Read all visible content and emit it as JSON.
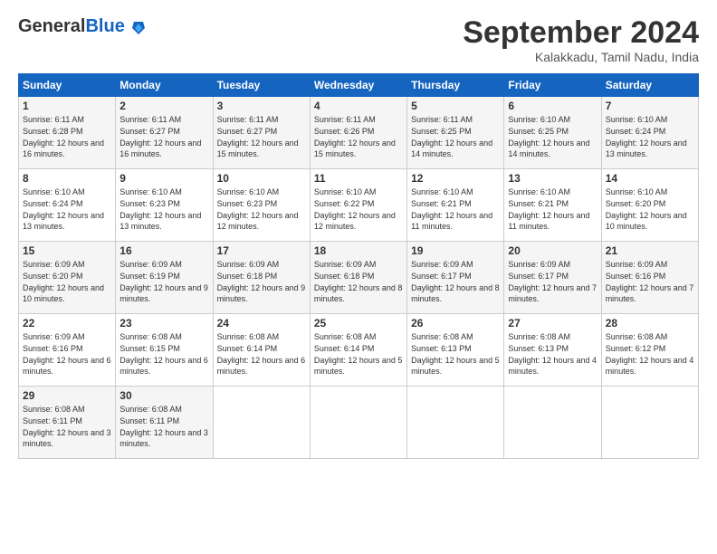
{
  "header": {
    "logo_general": "General",
    "logo_blue": "Blue",
    "month_title": "September 2024",
    "location": "Kalakkadu, Tamil Nadu, India"
  },
  "days_of_week": [
    "Sunday",
    "Monday",
    "Tuesday",
    "Wednesday",
    "Thursday",
    "Friday",
    "Saturday"
  ],
  "weeks": [
    [
      {
        "day": 1,
        "sunrise": "6:11 AM",
        "sunset": "6:28 PM",
        "daylight": "12 hours and 16 minutes."
      },
      {
        "day": 2,
        "sunrise": "6:11 AM",
        "sunset": "6:27 PM",
        "daylight": "12 hours and 16 minutes."
      },
      {
        "day": 3,
        "sunrise": "6:11 AM",
        "sunset": "6:27 PM",
        "daylight": "12 hours and 15 minutes."
      },
      {
        "day": 4,
        "sunrise": "6:11 AM",
        "sunset": "6:26 PM",
        "daylight": "12 hours and 15 minutes."
      },
      {
        "day": 5,
        "sunrise": "6:11 AM",
        "sunset": "6:25 PM",
        "daylight": "12 hours and 14 minutes."
      },
      {
        "day": 6,
        "sunrise": "6:10 AM",
        "sunset": "6:25 PM",
        "daylight": "12 hours and 14 minutes."
      },
      {
        "day": 7,
        "sunrise": "6:10 AM",
        "sunset": "6:24 PM",
        "daylight": "12 hours and 13 minutes."
      }
    ],
    [
      {
        "day": 8,
        "sunrise": "6:10 AM",
        "sunset": "6:24 PM",
        "daylight": "12 hours and 13 minutes."
      },
      {
        "day": 9,
        "sunrise": "6:10 AM",
        "sunset": "6:23 PM",
        "daylight": "12 hours and 13 minutes."
      },
      {
        "day": 10,
        "sunrise": "6:10 AM",
        "sunset": "6:23 PM",
        "daylight": "12 hours and 12 minutes."
      },
      {
        "day": 11,
        "sunrise": "6:10 AM",
        "sunset": "6:22 PM",
        "daylight": "12 hours and 12 minutes."
      },
      {
        "day": 12,
        "sunrise": "6:10 AM",
        "sunset": "6:21 PM",
        "daylight": "12 hours and 11 minutes."
      },
      {
        "day": 13,
        "sunrise": "6:10 AM",
        "sunset": "6:21 PM",
        "daylight": "12 hours and 11 minutes."
      },
      {
        "day": 14,
        "sunrise": "6:10 AM",
        "sunset": "6:20 PM",
        "daylight": "12 hours and 10 minutes."
      }
    ],
    [
      {
        "day": 15,
        "sunrise": "6:09 AM",
        "sunset": "6:20 PM",
        "daylight": "12 hours and 10 minutes."
      },
      {
        "day": 16,
        "sunrise": "6:09 AM",
        "sunset": "6:19 PM",
        "daylight": "12 hours and 9 minutes."
      },
      {
        "day": 17,
        "sunrise": "6:09 AM",
        "sunset": "6:18 PM",
        "daylight": "12 hours and 9 minutes."
      },
      {
        "day": 18,
        "sunrise": "6:09 AM",
        "sunset": "6:18 PM",
        "daylight": "12 hours and 8 minutes."
      },
      {
        "day": 19,
        "sunrise": "6:09 AM",
        "sunset": "6:17 PM",
        "daylight": "12 hours and 8 minutes."
      },
      {
        "day": 20,
        "sunrise": "6:09 AM",
        "sunset": "6:17 PM",
        "daylight": "12 hours and 7 minutes."
      },
      {
        "day": 21,
        "sunrise": "6:09 AM",
        "sunset": "6:16 PM",
        "daylight": "12 hours and 7 minutes."
      }
    ],
    [
      {
        "day": 22,
        "sunrise": "6:09 AM",
        "sunset": "6:16 PM",
        "daylight": "12 hours and 6 minutes."
      },
      {
        "day": 23,
        "sunrise": "6:08 AM",
        "sunset": "6:15 PM",
        "daylight": "12 hours and 6 minutes."
      },
      {
        "day": 24,
        "sunrise": "6:08 AM",
        "sunset": "6:14 PM",
        "daylight": "12 hours and 6 minutes."
      },
      {
        "day": 25,
        "sunrise": "6:08 AM",
        "sunset": "6:14 PM",
        "daylight": "12 hours and 5 minutes."
      },
      {
        "day": 26,
        "sunrise": "6:08 AM",
        "sunset": "6:13 PM",
        "daylight": "12 hours and 5 minutes."
      },
      {
        "day": 27,
        "sunrise": "6:08 AM",
        "sunset": "6:13 PM",
        "daylight": "12 hours and 4 minutes."
      },
      {
        "day": 28,
        "sunrise": "6:08 AM",
        "sunset": "6:12 PM",
        "daylight": "12 hours and 4 minutes."
      }
    ],
    [
      {
        "day": 29,
        "sunrise": "6:08 AM",
        "sunset": "6:11 PM",
        "daylight": "12 hours and 3 minutes."
      },
      {
        "day": 30,
        "sunrise": "6:08 AM",
        "sunset": "6:11 PM",
        "daylight": "12 hours and 3 minutes."
      },
      null,
      null,
      null,
      null,
      null
    ]
  ]
}
